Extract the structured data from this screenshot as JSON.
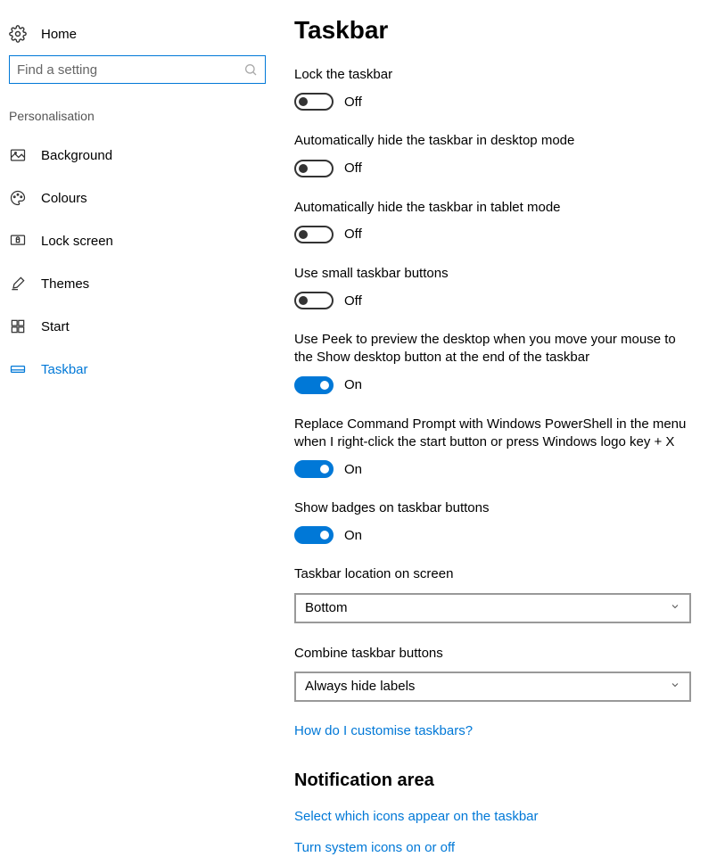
{
  "sidebar": {
    "home_label": "Home",
    "search_placeholder": "Find a setting",
    "category": "Personalisation",
    "items": [
      {
        "label": "Background"
      },
      {
        "label": "Colours"
      },
      {
        "label": "Lock screen"
      },
      {
        "label": "Themes"
      },
      {
        "label": "Start"
      },
      {
        "label": "Taskbar"
      }
    ]
  },
  "main": {
    "title": "Taskbar",
    "toggles": [
      {
        "label": "Lock the taskbar",
        "state": "Off"
      },
      {
        "label": "Automatically hide the taskbar in desktop mode",
        "state": "Off"
      },
      {
        "label": "Automatically hide the taskbar in tablet mode",
        "state": "Off"
      },
      {
        "label": "Use small taskbar buttons",
        "state": "Off"
      },
      {
        "label": "Use Peek to preview the desktop when you move your mouse to the Show desktop button at the end of the taskbar",
        "state": "On"
      },
      {
        "label": "Replace Command Prompt with Windows PowerShell in the menu when I right-click the start button or press Windows logo key + X",
        "state": "On"
      },
      {
        "label": "Show badges on taskbar buttons",
        "state": "On"
      }
    ],
    "dropdowns": [
      {
        "label": "Taskbar location on screen",
        "value": "Bottom"
      },
      {
        "label": "Combine taskbar buttons",
        "value": "Always hide labels"
      }
    ],
    "help_link": "How do I customise taskbars?",
    "notification_header": "Notification area",
    "notification_links": [
      "Select which icons appear on the taskbar",
      "Turn system icons on or off"
    ]
  }
}
